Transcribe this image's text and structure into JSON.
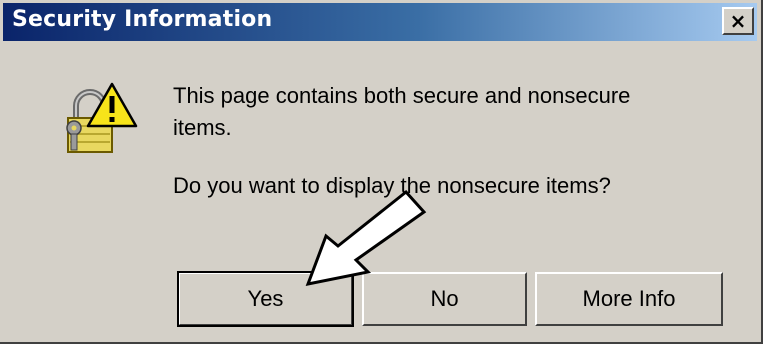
{
  "dialog": {
    "title": "Security Information",
    "close_symbol": "×",
    "icon": "padlock-warning-icon",
    "message_line1": "This page contains both secure and nonsecure",
    "message_line2": "items.",
    "question": "Do you want to display the nonsecure items?",
    "buttons": {
      "yes": "Yes",
      "no": "No",
      "more_info": "More Info"
    }
  },
  "annotation": {
    "icon": "pointer-arrow-icon",
    "points_to": "Yes"
  },
  "colors": {
    "dialog_face": "#d4d0c8",
    "title_gradient_start": "#0a246a",
    "title_gradient_end": "#a6caf0",
    "title_text": "#ffffff"
  }
}
